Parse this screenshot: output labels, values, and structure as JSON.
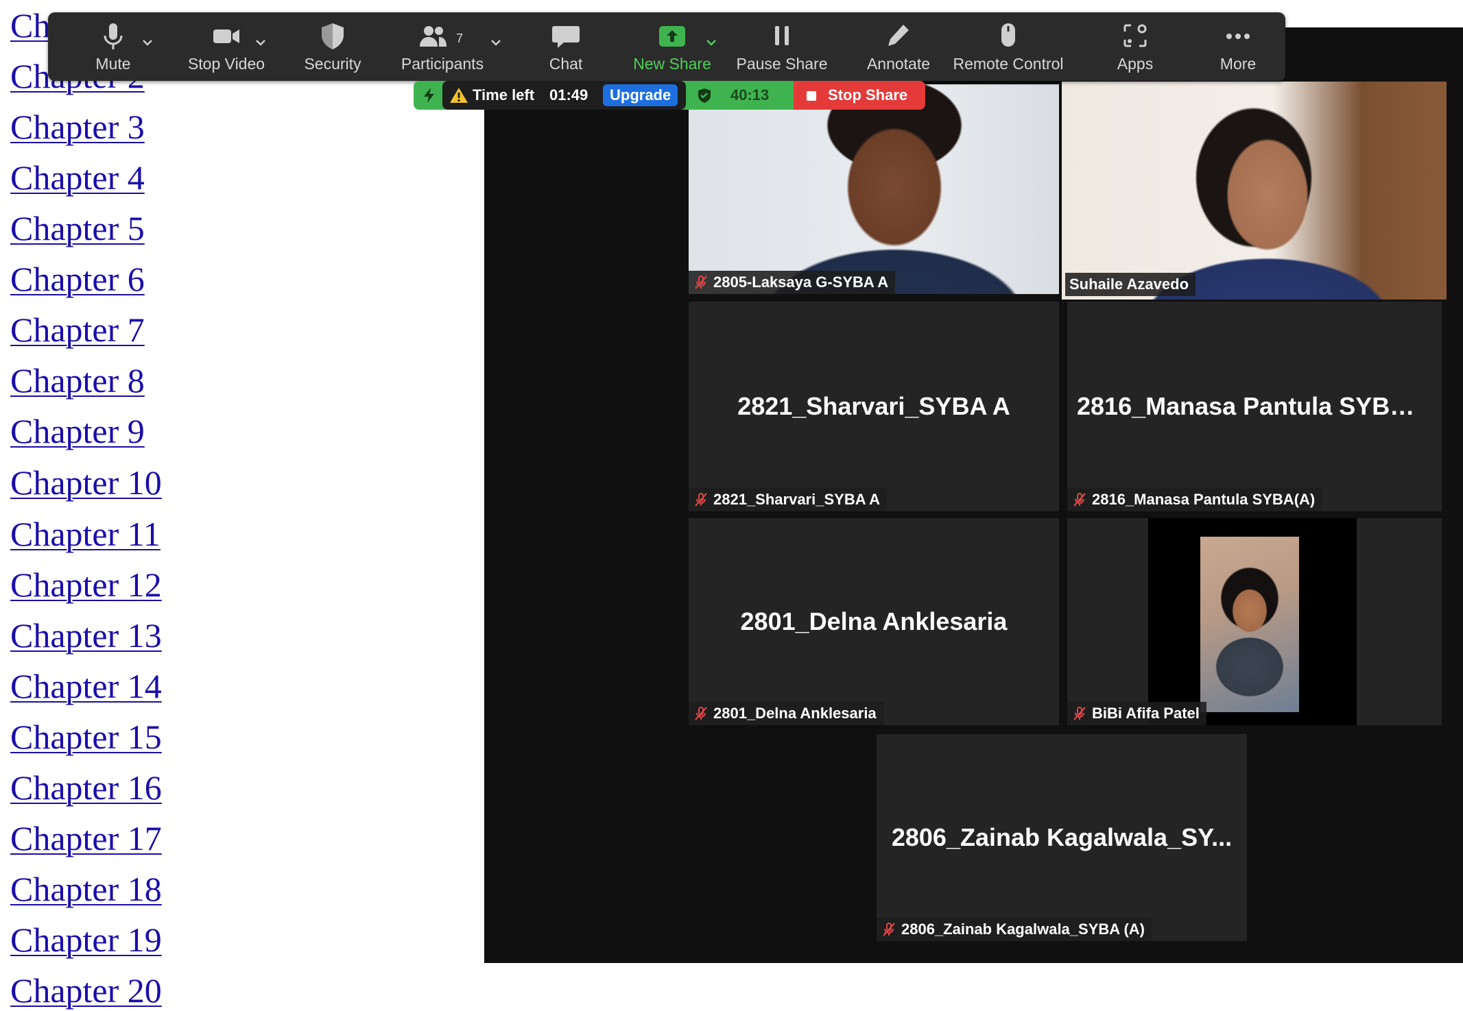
{
  "chapters": [
    "Chapter 1",
    "Chapter 2",
    "Chapter 3",
    "Chapter 4",
    "Chapter 5",
    "Chapter 6",
    "Chapter 7",
    "Chapter 8",
    "Chapter 9",
    "Chapter 10",
    "Chapter 11",
    "Chapter 12",
    "Chapter 13",
    "Chapter 14",
    "Chapter 15",
    "Chapter 16",
    "Chapter 17",
    "Chapter 18",
    "Chapter 19",
    "Chapter 20"
  ],
  "toolbar": {
    "mute": "Mute",
    "stop_video": "Stop Video",
    "security": "Security",
    "participants": "Participants",
    "participant_count": "7",
    "chat": "Chat",
    "new_share": "New Share",
    "pause_share": "Pause Share",
    "annotate": "Annotate",
    "remote_control": "Remote Control",
    "apps": "Apps",
    "more": "More"
  },
  "share_bar": {
    "time_left_label": "Time left",
    "time_left_value": "01:49",
    "upgrade": "Upgrade",
    "elapsed": "40:13",
    "stop_share": "Stop Share"
  },
  "participants": {
    "p1": {
      "name": "2805-Laksaya G-SYBA A"
    },
    "p2": {
      "name": "Suhaile Azavedo"
    },
    "p3": {
      "display": "2821_Sharvari_SYBA A",
      "name": "2821_Sharvari_SYBA A"
    },
    "p4": {
      "display": "2816_Manasa Pantula SYBA(...",
      "name": "2816_Manasa Pantula SYBA(A)"
    },
    "p5": {
      "display": "2801_Delna Anklesaria",
      "name": "2801_Delna Anklesaria"
    },
    "p6": {
      "name": "BiBi Afifa Patel"
    },
    "p7": {
      "display": "2806_Zainab Kagalwala_SY...",
      "name": "2806_Zainab Kagalwala_SYBA (A)"
    }
  },
  "colors": {
    "link": "#1a0dab",
    "accent_green": "#4fd05a",
    "active_speaker_border": "#c9e66a",
    "stop_share_red": "#e53a3a",
    "upgrade_blue": "#1d6fe0"
  }
}
